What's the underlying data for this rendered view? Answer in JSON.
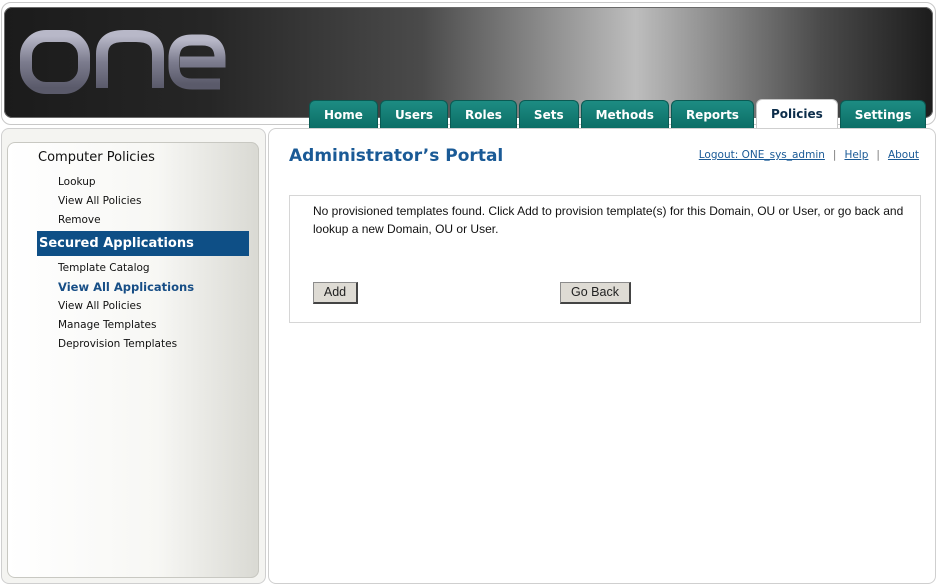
{
  "header": {
    "logo_text": "one",
    "tabs": [
      {
        "label": "Home",
        "active": false
      },
      {
        "label": "Users",
        "active": false
      },
      {
        "label": "Roles",
        "active": false
      },
      {
        "label": "Sets",
        "active": false
      },
      {
        "label": "Methods",
        "active": false
      },
      {
        "label": "Reports",
        "active": false
      },
      {
        "label": "Policies",
        "active": true
      },
      {
        "label": "Settings",
        "active": false
      }
    ]
  },
  "sidebar": {
    "computer_policies": {
      "heading": "Computer Policies",
      "items": [
        "Lookup",
        "View All Policies",
        "Remove"
      ]
    },
    "secured_applications": {
      "heading": "Secured Applications",
      "items": [
        "Template Catalog",
        "View All Applications",
        "View All Policies",
        "Manage Templates",
        "Deprovision Templates"
      ],
      "current": "View All Applications"
    }
  },
  "main": {
    "title": "Administrator’s Portal",
    "links": {
      "logout": "Logout: ONE_sys_admin",
      "help": "Help",
      "about": "About",
      "separator": "|"
    },
    "message": "No provisioned templates found. Click Add to provision template(s) for this Domain, OU or User, or go back and lookup a new Domain, OU or User.",
    "add_button": "Add",
    "back_button": "Go Back"
  },
  "colors": {
    "tab": "#0c6e66",
    "section_header": "#0e4f86",
    "title": "#1a5a96"
  }
}
